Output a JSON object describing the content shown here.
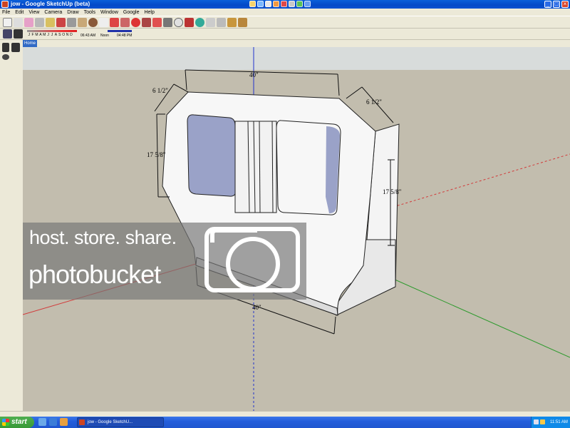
{
  "window": {
    "title": "jow - Google SketchUp (beta)"
  },
  "menu": {
    "items": [
      "File",
      "Edit",
      "View",
      "Camera",
      "Draw",
      "Tools",
      "Window",
      "Google",
      "Help"
    ]
  },
  "shadow_settings": {
    "months": [
      "J",
      "F",
      "M",
      "A",
      "M",
      "J",
      "J",
      "A",
      "S",
      "O",
      "N",
      "D"
    ],
    "time_start": "06:43 AM",
    "time_noon": "Noon",
    "time_end": "04:48 PM"
  },
  "scene_tabs": {
    "active": "Home"
  },
  "dimensions": {
    "top_width": "40\"",
    "bottom_width": "40\"",
    "left_chamfer": "6 1/2\"",
    "right_chamfer": "6 1/2\"",
    "left_height": "17 5/8\"",
    "right_height": "17 5/8\""
  },
  "watermark": {
    "line1": "host. store. share.",
    "line2": "photobucket"
  },
  "taskbar": {
    "start_label": "start",
    "task_label": "jow - Google SketchU...",
    "clock": "11:51 AM"
  },
  "colors": {
    "sky": "#d8dcdb",
    "ground": "#c2bdae",
    "red_axis": "#d23a3a",
    "green_axis": "#2c9a2c",
    "blue_axis": "#2233cc",
    "window_glass": "#9aa2c8"
  }
}
